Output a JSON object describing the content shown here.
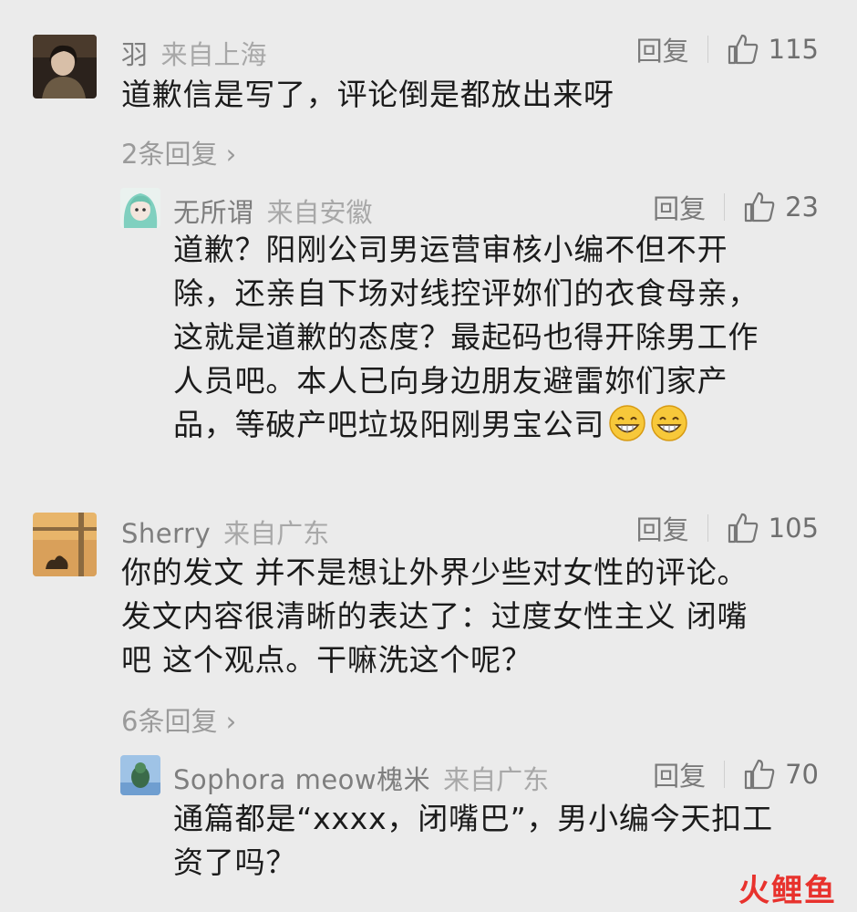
{
  "comments": [
    {
      "username": "羽",
      "location": "来自上海",
      "reply_label": "回复",
      "likes": "115",
      "text": "道歉信是写了，评论倒是都放出来呀",
      "replies_link": "2条回复",
      "replies": [
        {
          "username": "无所谓",
          "location": "来自安徽",
          "reply_label": "回复",
          "likes": "23",
          "lines": [
            "道歉？阳刚公司男运营审核小编不但不开",
            "除，还亲自下场对线控评妳们的衣食母亲，",
            "这就是道歉的态度？最起码也得开除男工作",
            "人员吧。本人已向身边朋友避雷妳们家产",
            "品，等破产吧垃圾阳刚男宝公司"
          ],
          "emoji": [
            "grin-emoji",
            "grin-emoji"
          ]
        }
      ]
    },
    {
      "username": "Sherry",
      "location": "来自广东",
      "reply_label": "回复",
      "likes": "105",
      "lines": [
        "你的发文 并不是想让外界少些对女性的评论。",
        "发文内容很清晰的表达了：过度女性主义 闭嘴",
        "吧 这个观点。干嘛洗这个呢？"
      ],
      "replies_link": "6条回复",
      "replies": [
        {
          "username": "Sophora meow槐米",
          "location": "来自广东",
          "reply_label": "回复",
          "likes": "70",
          "lines": [
            "通篇都是“xxxx，闭嘴巴”，男小编今天扣工",
            "资了吗？"
          ]
        }
      ]
    }
  ],
  "watermark": "火鲤鱼",
  "colors": {
    "background": "#ebebeb",
    "username": "#7e7e7e",
    "location": "#a8a8a8",
    "body_text": "#1b1b1b",
    "watermark_red": "#e8322d",
    "watermark_orange": "#f08a24"
  }
}
